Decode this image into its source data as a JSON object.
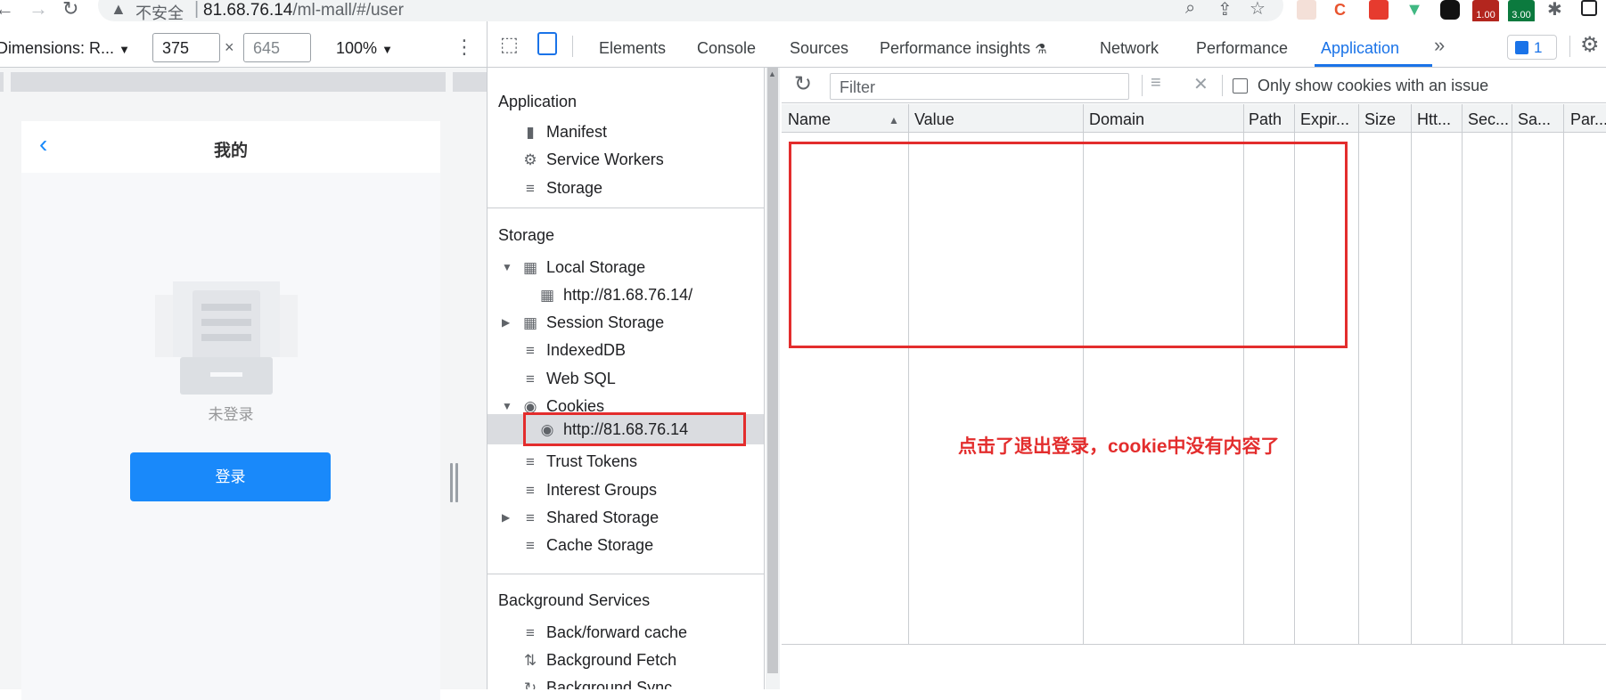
{
  "address_bar": {
    "security_label": "不安全",
    "url_host": "81.68.76.14",
    "url_path": "/ml-mall/#/user",
    "ext_badges": [
      "1.00",
      "3.00"
    ]
  },
  "device_toolbar": {
    "dimensions_label": "Dimensions: R...",
    "width": "375",
    "height": "645",
    "zoom": "100%"
  },
  "phone": {
    "title": "我的",
    "status_text": "未登录",
    "login_button": "登录"
  },
  "devtools": {
    "tabs": [
      "Elements",
      "Console",
      "Sources",
      "Performance insights",
      "Network",
      "Performance",
      "Application"
    ],
    "active_tab": "Application",
    "issues_count": "1"
  },
  "sidebar": {
    "sections": {
      "application": "Application",
      "storage": "Storage",
      "background": "Background Services"
    },
    "app_items": [
      "Manifest",
      "Service Workers",
      "Storage"
    ],
    "storage_items": {
      "local_storage": "Local Storage",
      "local_storage_origin": "http://81.68.76.14/",
      "session_storage": "Session Storage",
      "indexeddb": "IndexedDB",
      "websql": "Web SQL",
      "cookies": "Cookies",
      "cookies_origin": "http://81.68.76.14",
      "trust_tokens": "Trust Tokens",
      "interest_groups": "Interest Groups",
      "shared_storage": "Shared Storage",
      "cache_storage": "Cache Storage"
    },
    "background_items": [
      "Back/forward cache",
      "Background Fetch",
      "Background Sync"
    ]
  },
  "cookies_pane": {
    "filter_placeholder": "Filter",
    "only_issue_label": "Only show cookies with an issue",
    "columns": [
      "Name",
      "Value",
      "Domain",
      "Path",
      "Expir...",
      "Size",
      "Htt...",
      "Sec...",
      "Sa...",
      "Par..."
    ],
    "annotation": "点击了退出登录，cookie中没有内容了"
  },
  "colors": {
    "accent": "#1a73e8",
    "login_button": "#1989fa",
    "annotation_red": "#e32d2d"
  }
}
